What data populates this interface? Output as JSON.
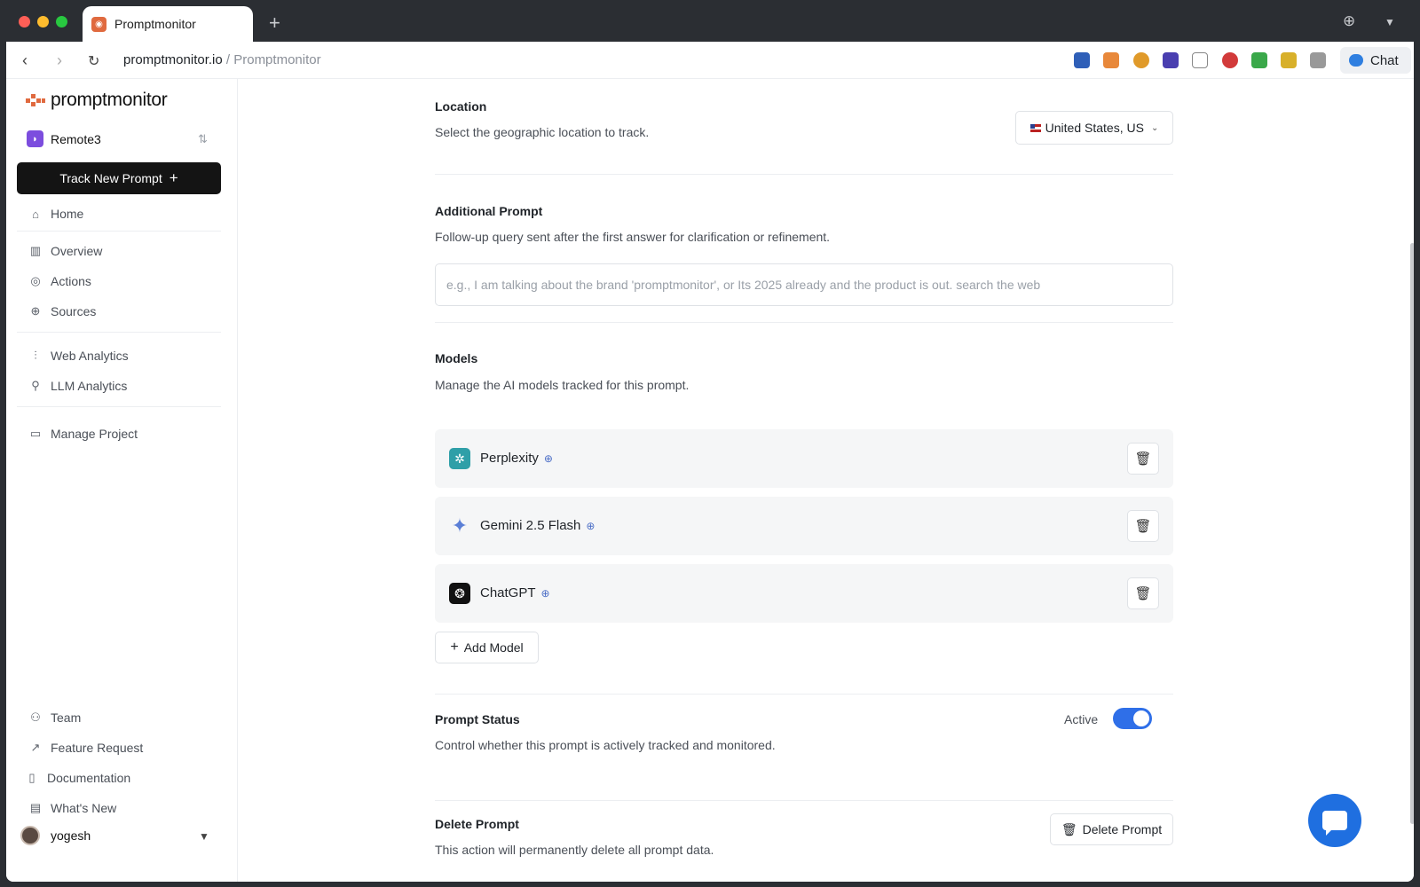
{
  "browser": {
    "tab_title": "Promptmonitor",
    "new_tab_icon": "plus-icon",
    "url_domain": "promptmonitor.io",
    "url_path": " / Promptmonitor",
    "chat_label": "Chat"
  },
  "sidebar": {
    "brand": "promptmonitor",
    "project_name": "Remote3",
    "track_button": "Track New Prompt",
    "items": [
      {
        "label": "Home",
        "icon": "home-icon"
      },
      {
        "label": "Overview",
        "icon": "chart-icon"
      },
      {
        "label": "Actions",
        "icon": "target-icon"
      },
      {
        "label": "Sources",
        "icon": "globe-icon"
      },
      {
        "label": "Web Analytics",
        "icon": "analytics-icon"
      },
      {
        "label": "LLM Analytics",
        "icon": "person-icon"
      },
      {
        "label": "Manage Project",
        "icon": "folder-icon"
      },
      {
        "label": "Team",
        "icon": "team-icon"
      },
      {
        "label": "Feature Request",
        "icon": "arrow-up-right-icon"
      },
      {
        "label": "Documentation",
        "icon": "book-icon"
      },
      {
        "label": "What's New",
        "icon": "news-icon"
      }
    ],
    "user_name": "yogesh"
  },
  "main": {
    "location": {
      "title": "Location",
      "description": "Select the geographic location to track.",
      "selected": "United States, US"
    },
    "additional_prompt": {
      "title": "Additional Prompt",
      "description": "Follow-up query sent after the first answer for clarification or refinement.",
      "placeholder": "e.g., I am talking about the brand 'promptmonitor', or Its 2025 already and the product is out. search the web",
      "value": ""
    },
    "models": {
      "title": "Models",
      "description": "Manage the AI models tracked for this prompt.",
      "items": [
        {
          "name": "Perplexity",
          "color": "#2f9fa8"
        },
        {
          "name": "Gemini 2.5 Flash",
          "color": "#5b7fd6"
        },
        {
          "name": "ChatGPT",
          "color": "#111111"
        }
      ],
      "add_label": "Add Model"
    },
    "status": {
      "title": "Prompt Status",
      "description": "Control whether this prompt is actively tracked and monitored.",
      "state_label": "Active",
      "enabled": true
    },
    "delete": {
      "title": "Delete Prompt",
      "description": "This action will permanently delete all prompt data.",
      "button_label": "Delete Prompt"
    }
  },
  "colors": {
    "accent": "#2f6fe8",
    "brand": "#e06a3f",
    "primary_button": "#141414"
  }
}
